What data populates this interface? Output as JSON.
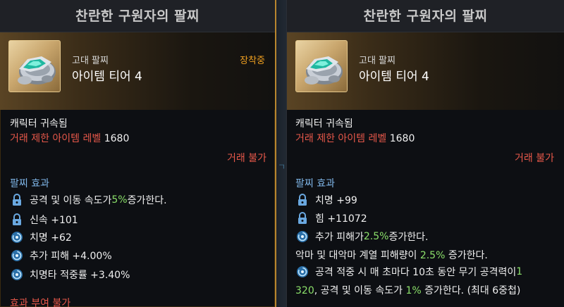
{
  "left": {
    "title": "찬란한 구원자의 팔찌",
    "grade": "고대 팔찌",
    "tier": "아이템 티어 4",
    "equipped": "장착중",
    "bound": "캐릭터 귀속됨",
    "trade_label": "거래 제한 아이템 레벨",
    "trade_level": "1680",
    "no_trade": "거래 불가",
    "effects_header": "팔찌 효과",
    "effects": [
      {
        "icon": "lock-icon",
        "pre": "공격 및 이동 속도가 ",
        "hl": "5%",
        "post": " 증가한다."
      },
      {
        "icon": "lock-icon",
        "text": "신속 +101"
      },
      {
        "icon": "swirl-icon",
        "text": "치명 +62"
      },
      {
        "icon": "swirl-icon",
        "text": "추가 피해 +4.00%"
      },
      {
        "icon": "swirl-icon",
        "text": "치명타 적중률 +3.40%"
      }
    ],
    "footer": "효과 부여 불가"
  },
  "right": {
    "title": "찬란한 구원자의 팔찌",
    "grade": "고대 팔찌",
    "tier": "아이템 티어 4",
    "bound": "캐릭터 귀속됨",
    "trade_label": "거래 제한 아이템 레벨",
    "trade_level": "1680",
    "no_trade": "거래 불가",
    "effects_header": "팔찌 효과",
    "stat1": "치명 +99",
    "stat2": "힘 +11072",
    "effect3_pre": "추가 피해가 ",
    "effect3_hl": "2.5%",
    "effect3_post": " 증가한다.",
    "effect4_pre": "악마 및 대악마 계열 피해량이 ",
    "effect4_hl": "2.5%",
    "effect4_post": " 증가한다.",
    "effect5_line1_pre": "공격 적중 시 매 초마다 10초 동안 무기 공격력이 ",
    "effect5_line1_hl": "1",
    "effect5_line2_hl": "320",
    "effect5_line2_mid": ", 공격 및 이동 속도가 ",
    "effect5_line2_hl2": "1%",
    "effect5_line2_post": " 증가한다. (최대 6중첩)"
  },
  "colors": {
    "red": "#e8584a",
    "green": "#8be06a",
    "blue_header": "#7fb6e8",
    "equipped": "#f0a020",
    "gold_border": "#b8862e"
  }
}
